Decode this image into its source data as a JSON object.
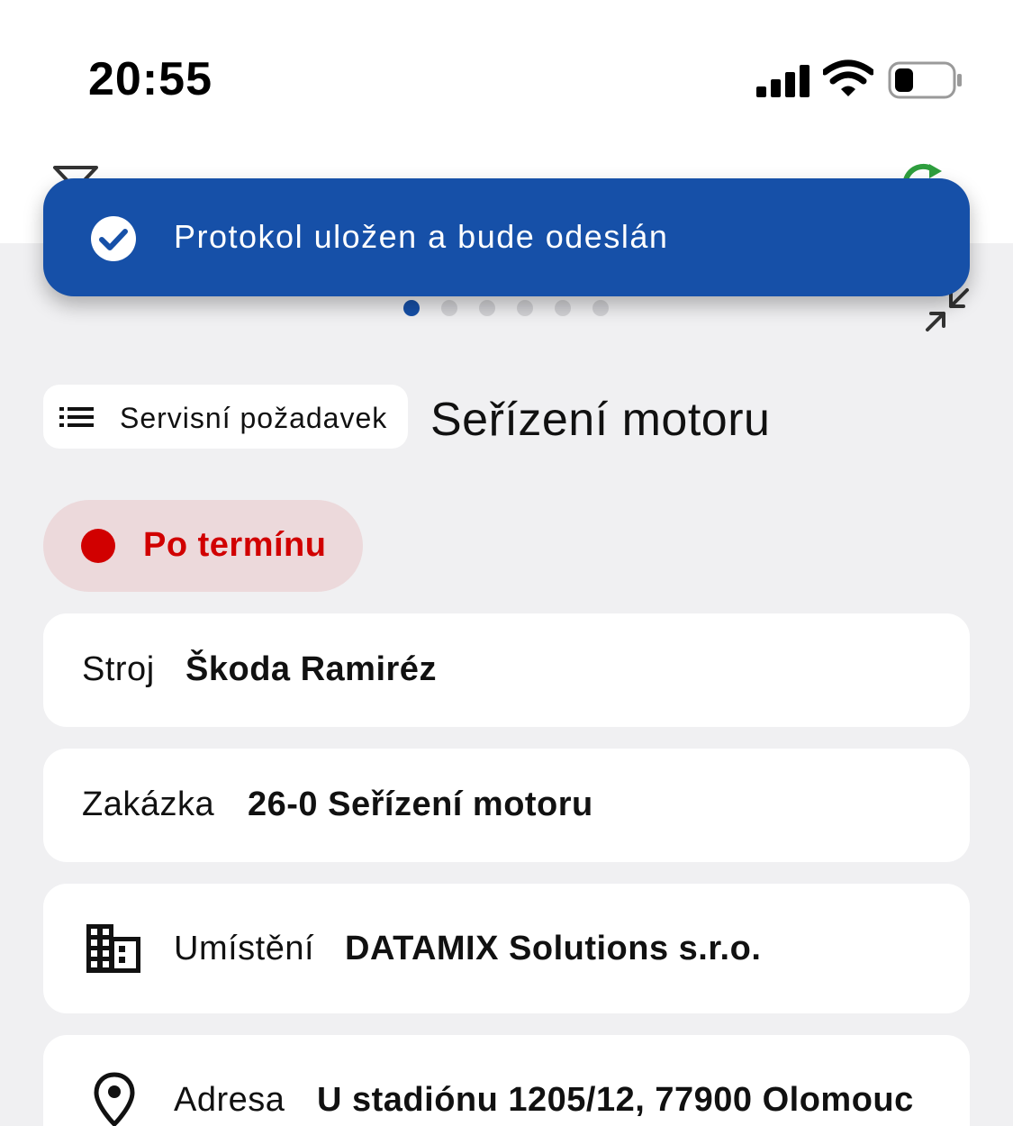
{
  "status_bar": {
    "time": "20:55",
    "icons": [
      "cellular-signal-icon",
      "wifi-icon",
      "battery-low-icon"
    ]
  },
  "top_bar": {
    "icons": [
      "filter-icon",
      "sync-icon"
    ],
    "sync_icon_color": "#2e9e3e"
  },
  "toast": {
    "icon": "check-circle-icon",
    "message": "Protokol uložen a bude odeslán",
    "background": "#1650a8"
  },
  "pager": {
    "page_count": 6,
    "current_page": 1,
    "active_color": "#1650a8"
  },
  "header": {
    "chip_icon": "list-icon",
    "chip_label": "Servisní požadavek",
    "title": "Seřízení motoru",
    "collapse_icon": "collapse-icon"
  },
  "status_badge": {
    "label": "Po termínu",
    "color": "#d10000",
    "background": "#ecd9db"
  },
  "details": [
    {
      "label": "Stroj",
      "value": "Škoda Ramiréz"
    },
    {
      "label": "Zakázka",
      "value": "26-0 Seřízení motoru"
    },
    {
      "label": "Umístění",
      "value": "DATAMIX Solutions s.r.o.",
      "icon": "building-icon"
    },
    {
      "label": "Adresa",
      "value": "U stadiónu 1205/12, 77900 Olomouc",
      "icon": "location-pin-icon"
    }
  ]
}
